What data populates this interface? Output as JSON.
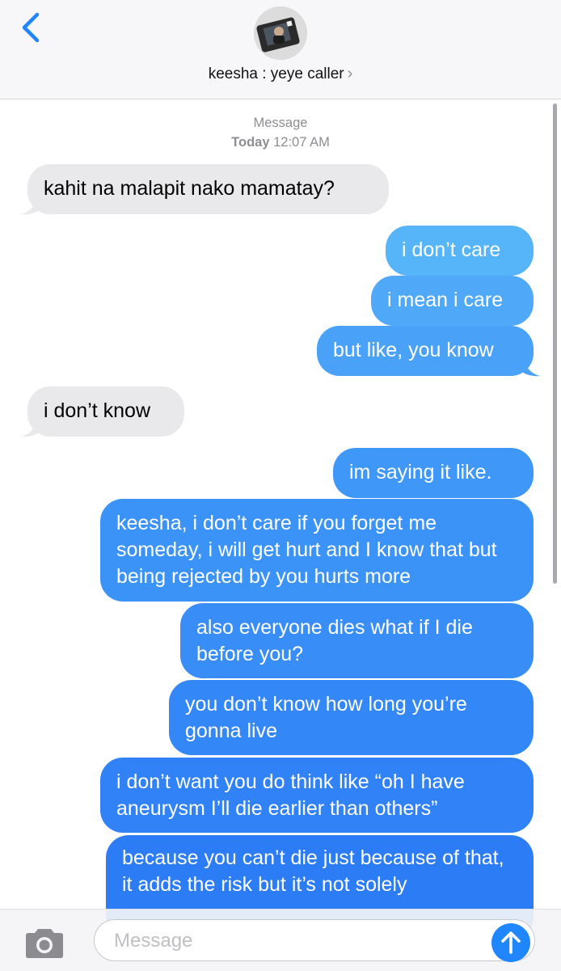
{
  "colors": {
    "accent": "#1f86fe",
    "incoming_bubble": "#e9e9eb",
    "outgoing_gradient_top": "#55b5f8",
    "outgoing_gradient_bottom": "#2b7af5"
  },
  "header": {
    "back_icon": "chevron-left-icon",
    "contact_name": "keesha : yeye caller",
    "contact_chevron": "›"
  },
  "timestamp": {
    "service": "Message",
    "day": "Today",
    "time": "12:07 AM"
  },
  "messages": [
    {
      "dir": "in",
      "text": "kahit na malapit nako mamatay?"
    },
    {
      "dir": "out",
      "text": "i don’t care"
    },
    {
      "dir": "out",
      "text": "i mean i care"
    },
    {
      "dir": "out",
      "text": "but like, you know"
    },
    {
      "dir": "in",
      "text": "i don’t know"
    },
    {
      "dir": "out",
      "text": "im saying it like."
    },
    {
      "dir": "out",
      "text": "keesha, i don’t care if you forget me someday, i will get hurt and I know that but being rejected by you hurts more"
    },
    {
      "dir": "out",
      "text": "also everyone dies what if I die before you?"
    },
    {
      "dir": "out",
      "text": "you don’t know how long you’re gonna live"
    },
    {
      "dir": "out",
      "text": "i don’t want you do think like “oh I have aneurysm I’ll die earlier than others”"
    },
    {
      "dir": "out",
      "text": "because you can’t die just because of that, it adds the risk but it’s not solely"
    }
  ],
  "composer": {
    "camera_icon": "camera-icon",
    "placeholder": "Message",
    "send_icon": "arrow-up-icon"
  }
}
